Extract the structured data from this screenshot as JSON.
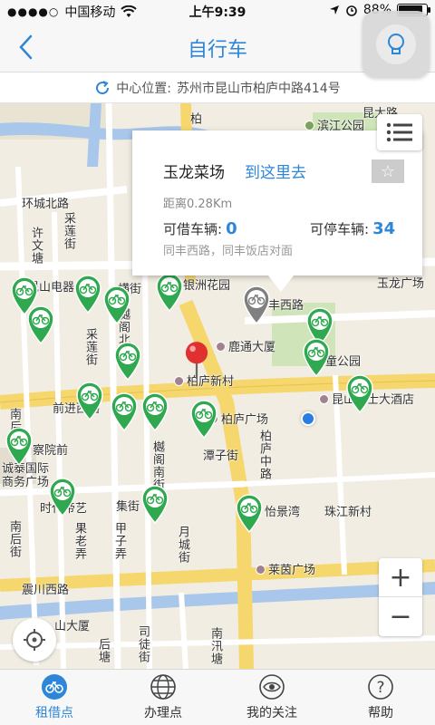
{
  "status_bar": {
    "signal_dots": "●●●●○",
    "carrier": "中国移动",
    "time": "上午9:39",
    "battery": "88%",
    "battery_level": 0.88
  },
  "nav": {
    "title": "自行车"
  },
  "location": {
    "label": "中心位置:",
    "address": "苏州市昆山市柏庐中路414号"
  },
  "popup": {
    "name": "玉龙菜场",
    "goto": "到这里去",
    "fav_icon": "star-icon",
    "distance": "距离0.28Km",
    "borrow_label": "可借车辆:",
    "borrow_count": "0",
    "return_label": "可停车辆:",
    "return_count": "34",
    "address": "同丰西路，同丰饭店对面"
  },
  "map_labels": {
    "l1": "昆太路",
    "l2": "滨江公园",
    "l3": "柏",
    "l4": "环城北路",
    "l5": "许文塘",
    "l6": "采莲街",
    "l7": "昆山电器",
    "l8": "横街",
    "l9": "银洲花园",
    "l10": "玉龙广场",
    "l11": "丰西路",
    "l12": "樾阁北",
    "l13": "采莲街",
    "l14": "鹿通大厦",
    "l15": "儿童公园",
    "l16": "柏庐新村",
    "l17": "前进西路",
    "l18": "昆山瑞士大酒店",
    "l19": "柏庐广场",
    "l20": "南后街",
    "l21": "察院前",
    "l22": "诚泰国际商务广场",
    "l23": "潭子街",
    "l24": "樾阁南街",
    "l25": "柏庐中路",
    "l26": "时代帝艺",
    "l27": "集街",
    "l28": "怡景湾",
    "l29": "珠江新村",
    "l30": "南后街",
    "l31": "果老弄",
    "l32": "甲子弄",
    "l33": "月城街",
    "l34": "莱茵广场",
    "l35": "震川西路",
    "l36": "山大厦",
    "l37": "后塘",
    "l38": "司徒街",
    "l39": "南汛塘"
  },
  "tabs": [
    {
      "label": "租借点",
      "icon": "bike-icon"
    },
    {
      "label": "办理点",
      "icon": "globe-icon"
    },
    {
      "label": "我的关注",
      "icon": "eye-icon"
    },
    {
      "label": "帮助",
      "icon": "help-icon"
    }
  ],
  "colors": {
    "accent": "#2e86d9",
    "pin_green": "#2fa84f",
    "selected_pin": "#808080",
    "target_pin": "#e03030"
  }
}
